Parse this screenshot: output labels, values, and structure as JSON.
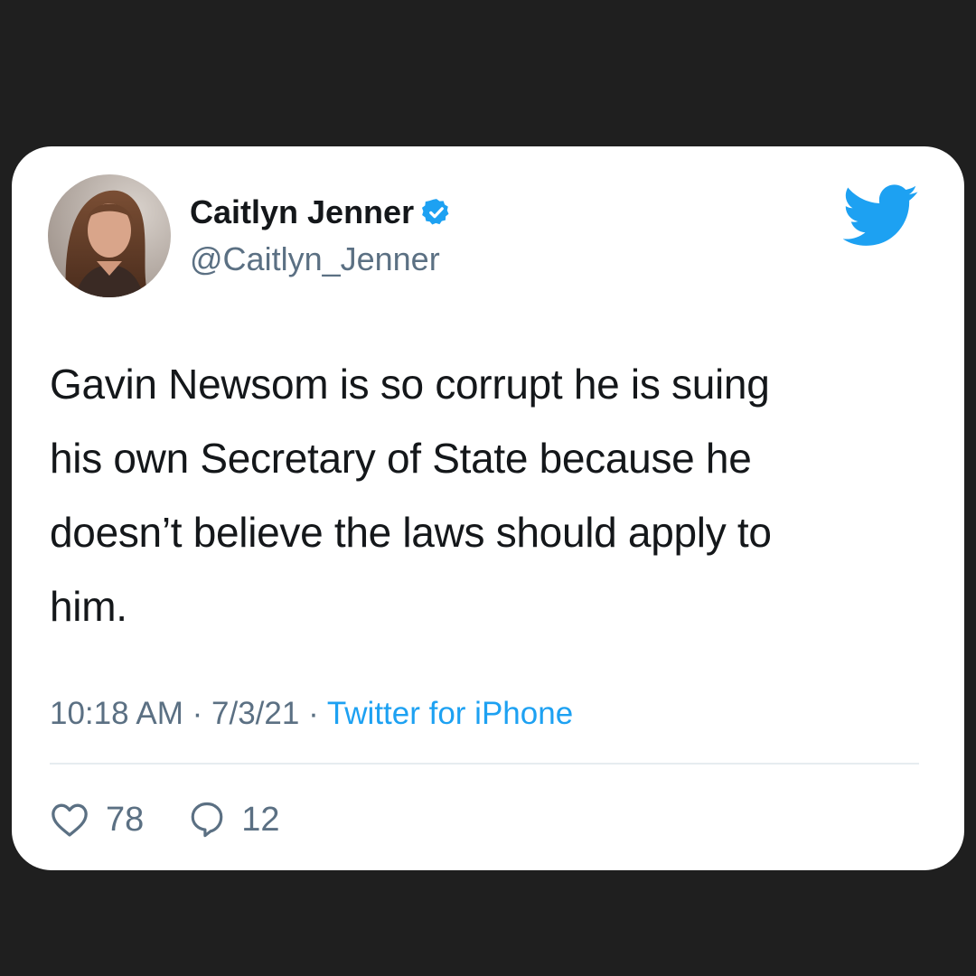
{
  "tweet": {
    "author": {
      "display_name": "Caitlyn Jenner",
      "handle": "@Caitlyn_Jenner",
      "verified": true,
      "avatar_icon": "profile-photo"
    },
    "text_lines": [
      "Gavin Newsom is so corrupt he is suing",
      "his own Secretary of State because he",
      "doesn’t believe the laws should apply to",
      "him."
    ],
    "time": "10:18 AM",
    "date": "7/3/21",
    "separator": "·",
    "source": "Twitter for iPhone",
    "likes_count": "78",
    "replies_count": "12"
  },
  "icons": {
    "verified": "verified-badge-icon",
    "brand": "twitter-bird-icon",
    "like": "heart-icon",
    "reply": "speech-bubble-icon"
  },
  "colors": {
    "background": "#1f1f1f",
    "card": "#ffffff",
    "text": "#14171a",
    "secondary_text": "#5b7083",
    "accent": "#1da1f2",
    "divider": "#e6ecf0"
  }
}
